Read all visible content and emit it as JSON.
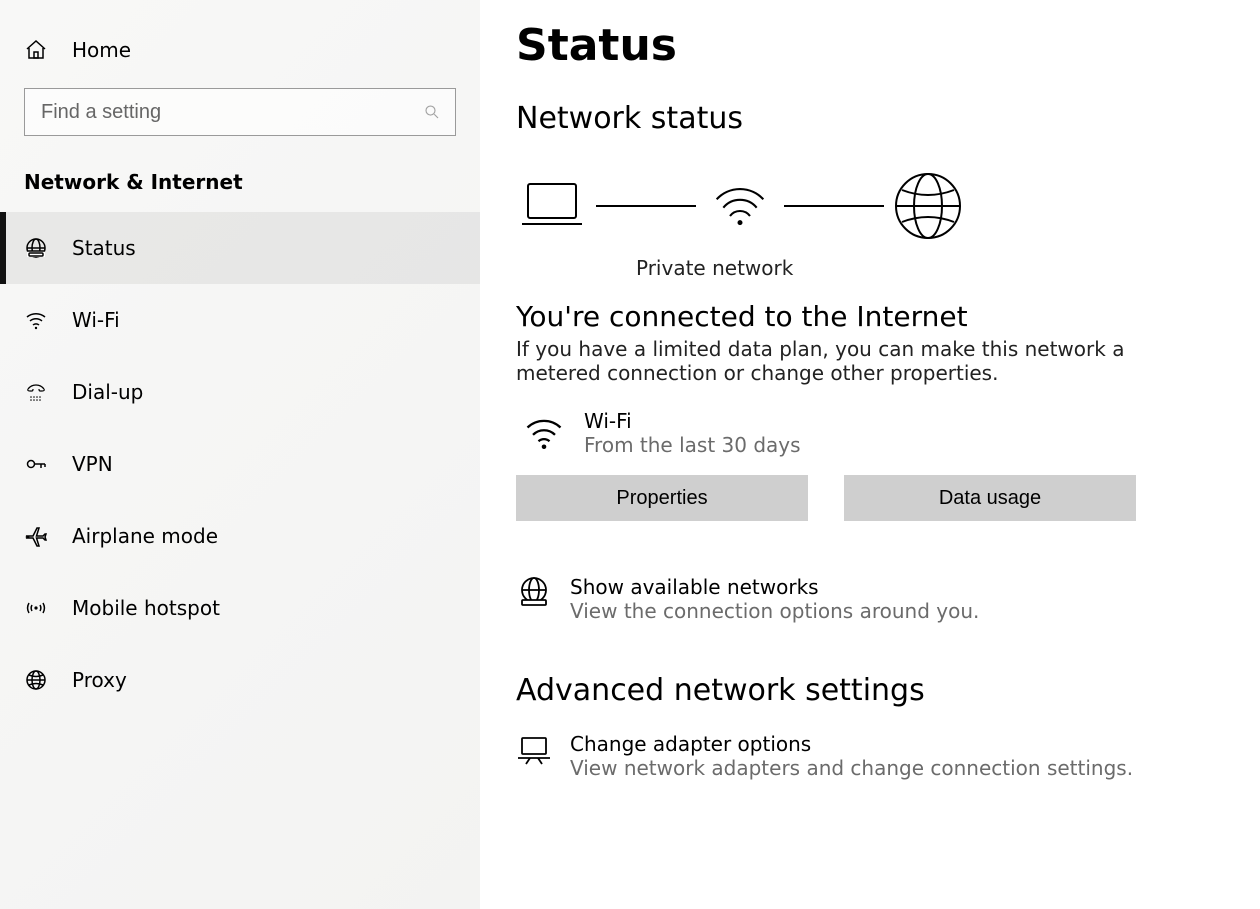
{
  "sidebar": {
    "home": "Home",
    "search_placeholder": "Find a setting",
    "category": "Network & Internet",
    "items": [
      {
        "label": "Status"
      },
      {
        "label": "Wi-Fi"
      },
      {
        "label": "Dial-up"
      },
      {
        "label": "VPN"
      },
      {
        "label": "Airplane mode"
      },
      {
        "label": "Mobile hotspot"
      },
      {
        "label": "Proxy"
      }
    ]
  },
  "main": {
    "page_title": "Status",
    "network_status_heading": "Network status",
    "network_label": "Private network",
    "connected_heading": "You're connected to the Internet",
    "connected_body": "If you have a limited data plan, you can make this network a metered connection or change other properties.",
    "connection": {
      "name": "Wi-Fi",
      "sub": "From the last 30 days"
    },
    "properties_btn": "Properties",
    "data_usage_btn": "Data usage",
    "show_networks_title": "Show available networks",
    "show_networks_sub": "View the connection options around you.",
    "advanced_heading": "Advanced network settings",
    "adapter_title": "Change adapter options",
    "adapter_sub": "View network adapters and change connection settings."
  }
}
